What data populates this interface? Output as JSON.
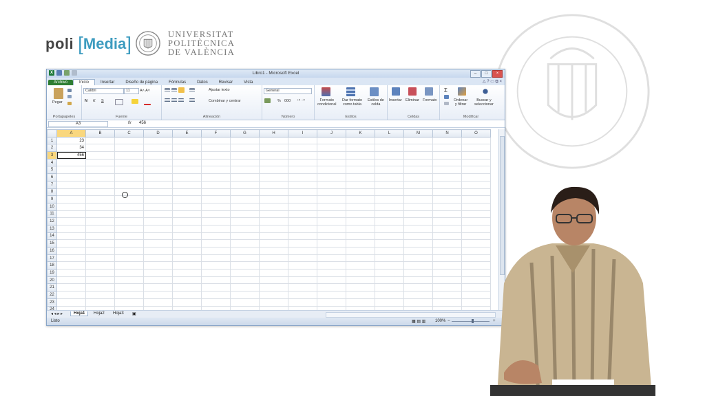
{
  "branding": {
    "poli": "poli",
    "media": "Media",
    "upv_lines": [
      "UNIVERSITAT",
      "POLITÈCNICA",
      "DE VALÈNCIA"
    ]
  },
  "window": {
    "title": "Libro1 - Microsoft Excel"
  },
  "ribbon_tabs": [
    "Archivo",
    "Inicio",
    "Insertar",
    "Diseño de página",
    "Fórmulas",
    "Datos",
    "Revisar",
    "Vista"
  ],
  "ribbon": {
    "portapapeles": {
      "label": "Portapapeles",
      "paste": "Pegar"
    },
    "fuente": {
      "label": "Fuente",
      "font": "Calibri",
      "size": "11",
      "bold": "N",
      "italic": "K",
      "underline": "S"
    },
    "alineacion": {
      "label": "Alineación",
      "wrap": "Ajustar texto",
      "merge": "Combinar y centrar"
    },
    "numero": {
      "label": "Número",
      "format": "General",
      "percent": "%",
      "thousands": "000"
    },
    "estilos": {
      "label": "Estilos",
      "cond1": "Formato",
      "cond2": "condicional",
      "table1": "Dar formato",
      "table2": "como tabla",
      "cell1": "Estilos de",
      "cell2": "celda"
    },
    "celdas": {
      "label": "Celdas",
      "insert": "Insertar",
      "delete": "Eliminar",
      "format": "Formato"
    },
    "modificar": {
      "label": "Modificar",
      "sort1": "Ordenar",
      "sort2": "y filtrar",
      "find1": "Buscar y",
      "find2": "seleccionar"
    }
  },
  "formula_bar": {
    "namebox": "A3",
    "fx": "fx",
    "value": "456"
  },
  "columns": [
    "A",
    "B",
    "C",
    "D",
    "E",
    "F",
    "G",
    "H",
    "I",
    "J",
    "K",
    "L",
    "M",
    "N",
    "O"
  ],
  "rows": [
    "1",
    "2",
    "3",
    "4",
    "5",
    "6",
    "7",
    "8",
    "9",
    "10",
    "11",
    "12",
    "13",
    "14",
    "15",
    "16",
    "17",
    "18",
    "19",
    "20",
    "21",
    "22",
    "23",
    "24"
  ],
  "cells": {
    "A1": "23",
    "A2": "34",
    "A3": "456"
  },
  "sheets": [
    "Hoja1",
    "Hoja2",
    "Hoja3"
  ],
  "status": {
    "mode": "Listo",
    "zoom": "100%",
    "zoom_minus": "−",
    "zoom_plus": "+"
  }
}
